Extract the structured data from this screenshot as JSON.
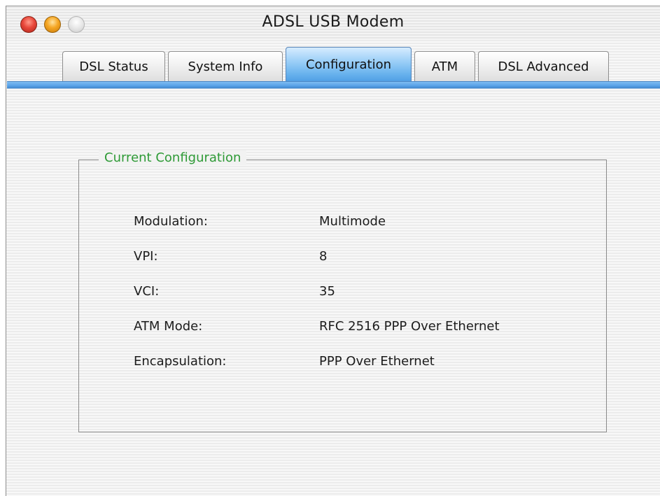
{
  "window": {
    "title": "ADSL USB Modem"
  },
  "tabs": [
    {
      "label": "DSL Status",
      "active": false
    },
    {
      "label": "System Info",
      "active": false
    },
    {
      "label": "Configuration",
      "active": true
    },
    {
      "label": "ATM",
      "active": false
    },
    {
      "label": "DSL Advanced",
      "active": false
    }
  ],
  "current_configuration": {
    "legend": "Current Configuration",
    "rows": [
      {
        "label": "Modulation:",
        "value": "Multimode"
      },
      {
        "label": "VPI:",
        "value": "8"
      },
      {
        "label": "VCI:",
        "value": "35"
      },
      {
        "label": "ATM Mode:",
        "value": "RFC 2516 PPP Over Ethernet"
      },
      {
        "label": "Encapsulation:",
        "value": "PPP Over Ethernet"
      }
    ]
  },
  "colors": {
    "legend_text": "#2e9a36",
    "active_tab": "#6bb4ee",
    "close_button": "#e8473a",
    "minimize_button": "#f5a623"
  },
  "icons": {
    "close": "close-icon",
    "minimize": "minimize-icon",
    "zoom": "zoom-icon"
  }
}
